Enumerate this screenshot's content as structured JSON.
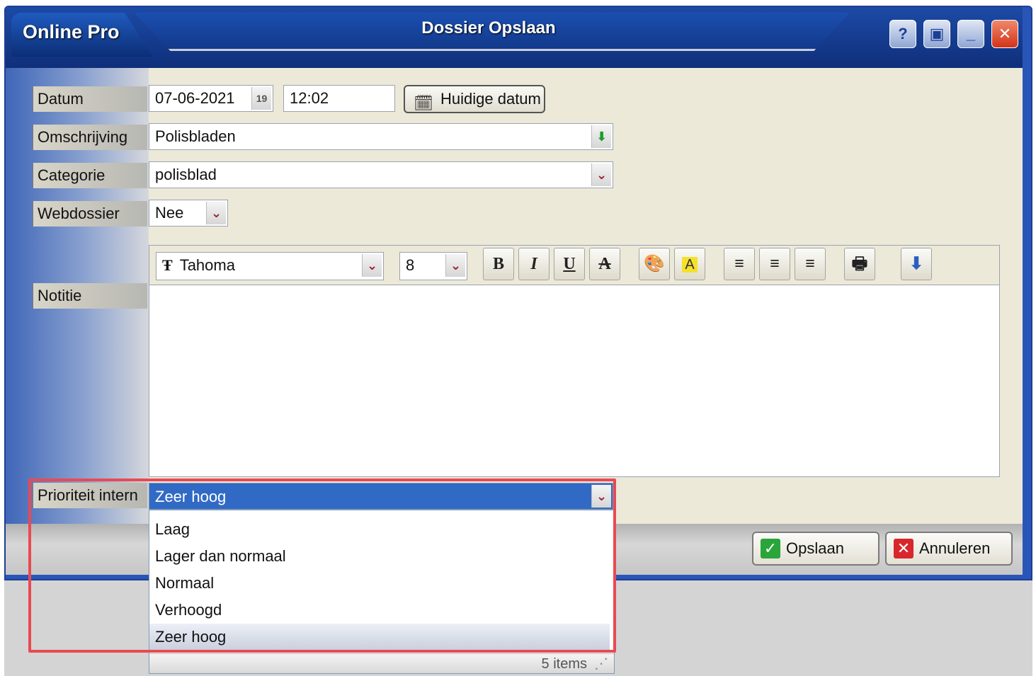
{
  "window": {
    "app_title": "Online Pro",
    "dialog_title": "Dossier Opslaan",
    "buttons": {
      "help": "?",
      "restore": "▣",
      "minimize": "_",
      "close": "✕"
    }
  },
  "labels": {
    "datum": "Datum",
    "omschrijving": "Omschrijving",
    "categorie": "Categorie",
    "webdossier": "Webdossier",
    "notitie": "Notitie",
    "prioriteit": "Prioriteit intern"
  },
  "fields": {
    "date": "07-06-2021",
    "time": "12:02",
    "huidige_datum_button": "Huidige datum",
    "omschrijving": "Polisbladen",
    "categorie": "polisblad",
    "webdossier": "Nee"
  },
  "toolbar": {
    "font": "Tahoma",
    "size": "8",
    "bold": "B",
    "italic": "I",
    "underline": "U",
    "strike": "A",
    "highlight": "A"
  },
  "priority": {
    "selected": "Zeer hoog",
    "options": [
      "Laag",
      "Lager dan normaal",
      "Normaal",
      "Verhoogd",
      "Zeer hoog"
    ],
    "status": "5 items"
  },
  "actions": {
    "save": "Opslaan",
    "cancel": "Annuleren"
  },
  "colors": {
    "title_blue": "#1d4aa6",
    "highlight_red": "#e84a52",
    "selected_blue": "#316ac5"
  }
}
